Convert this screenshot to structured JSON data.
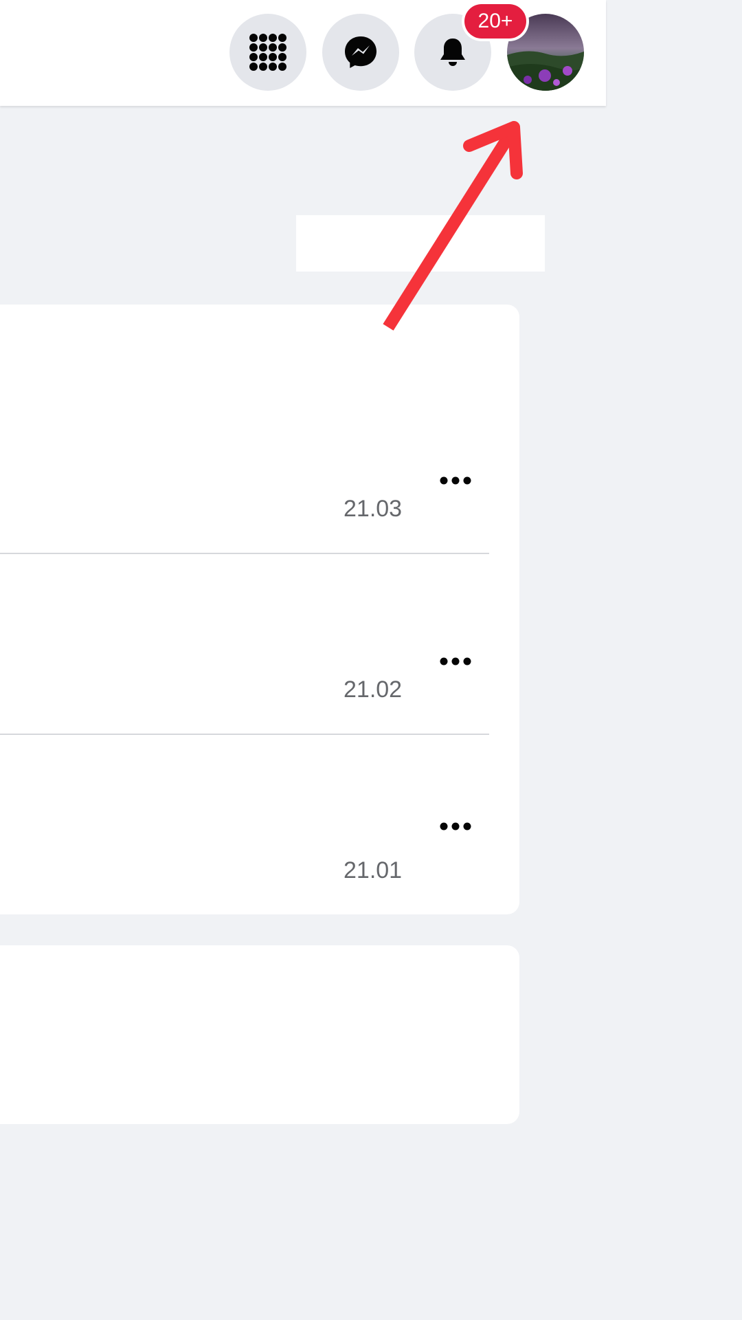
{
  "topbar": {
    "icons": [
      "menu-grid-icon",
      "messenger-icon",
      "bell-icon"
    ],
    "notification_badge": "20+"
  },
  "posts": [
    {
      "date": "21.03"
    },
    {
      "date": "21.02"
    },
    {
      "date": "21.01"
    }
  ],
  "colors": {
    "background": "#f0f2f5",
    "badge": "#e41e3f",
    "arrow": "#f5333a"
  }
}
